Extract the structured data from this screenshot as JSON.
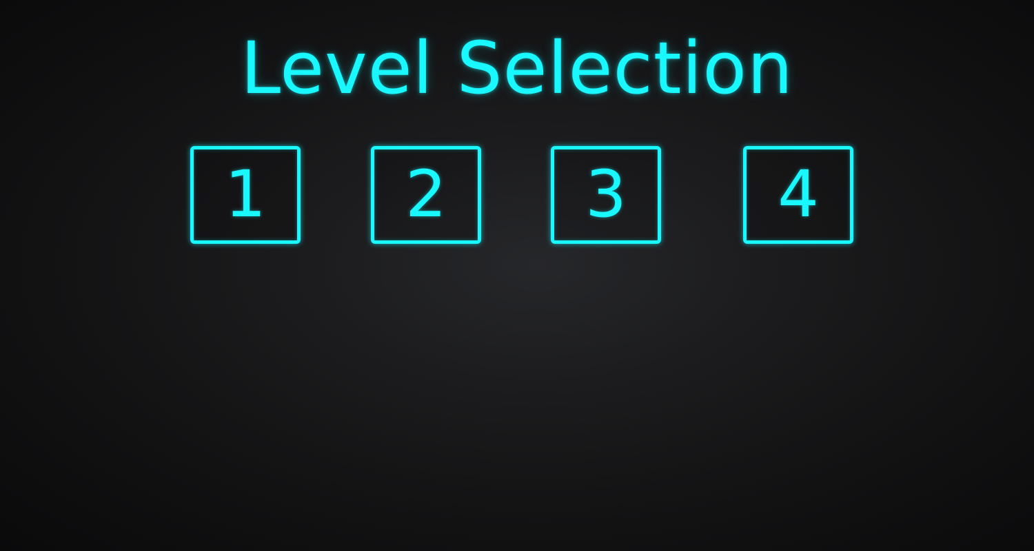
{
  "screen": {
    "title": "Level Selection",
    "accent_color": "#19f7ff",
    "background_color": "#1c1c1e"
  },
  "levels": [
    {
      "label": "1"
    },
    {
      "label": "2"
    },
    {
      "label": "3"
    },
    {
      "label": "4"
    }
  ]
}
